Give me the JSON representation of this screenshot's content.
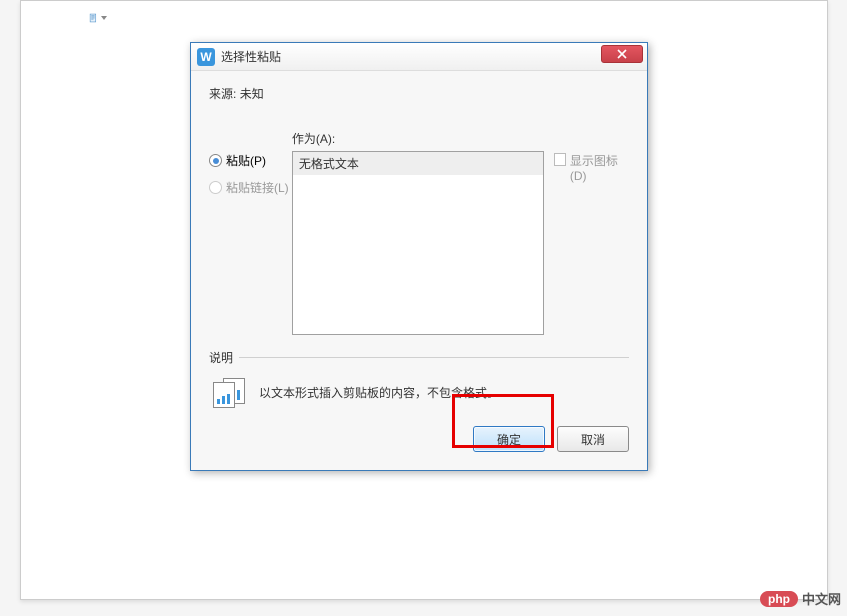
{
  "dialog": {
    "title": "选择性粘贴",
    "source_label": "来源:",
    "source_value": "未知",
    "as_label": "作为(A):",
    "radios": {
      "paste": {
        "label": "粘贴(P)",
        "checked": true,
        "enabled": true
      },
      "paste_link": {
        "label": "粘贴链接(L)",
        "checked": false,
        "enabled": false
      }
    },
    "list_items": [
      "无格式文本"
    ],
    "show_icon_label": "显示图标(D)",
    "desc_header": "说明",
    "desc_text": "以文本形式插入剪贴板的内容，不包含格式。",
    "ok_label": "确定",
    "cancel_label": "取消"
  },
  "watermark": {
    "pill": "php",
    "text": "中文网"
  }
}
